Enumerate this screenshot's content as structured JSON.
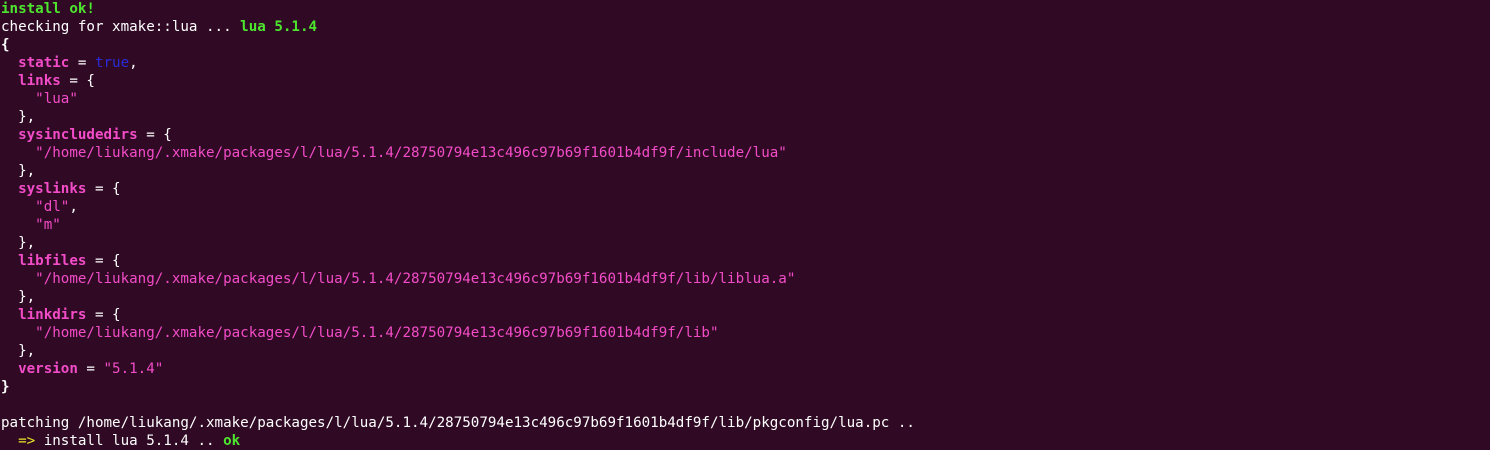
{
  "lines": [
    {
      "id": "install-ok",
      "segments": [
        {
          "t": "install ok!",
          "c": "g"
        }
      ]
    },
    {
      "id": "checking",
      "segments": [
        {
          "t": "checking for xmake::lua ... ",
          "c": "w"
        },
        {
          "t": "lua 5.1.4",
          "c": "g"
        }
      ]
    },
    {
      "id": "open-brace",
      "segments": [
        {
          "t": "{",
          "c": "wb"
        }
      ]
    },
    {
      "id": "static",
      "segments": [
        {
          "t": "  ",
          "c": "w"
        },
        {
          "t": "static",
          "c": "mb"
        },
        {
          "t": " = ",
          "c": "w"
        },
        {
          "t": "true",
          "c": "b"
        },
        {
          "t": ",",
          "c": "w"
        }
      ]
    },
    {
      "id": "links",
      "segments": [
        {
          "t": "  ",
          "c": "w"
        },
        {
          "t": "links",
          "c": "mb"
        },
        {
          "t": " = {",
          "c": "w"
        }
      ]
    },
    {
      "id": "links-lua",
      "segments": [
        {
          "t": "    ",
          "c": "w"
        },
        {
          "t": "\"lua\"",
          "c": "m"
        }
      ]
    },
    {
      "id": "links-close",
      "segments": [
        {
          "t": "  },",
          "c": "w"
        }
      ]
    },
    {
      "id": "sysincludedirs",
      "segments": [
        {
          "t": "  ",
          "c": "w"
        },
        {
          "t": "sysincludedirs",
          "c": "mb"
        },
        {
          "t": " = {",
          "c": "w"
        }
      ]
    },
    {
      "id": "sysincludedirs-path",
      "segments": [
        {
          "t": "    ",
          "c": "w"
        },
        {
          "t": "\"/home/liukang/.xmake/packages/l/lua/5.1.4/28750794e13c496c97b69f1601b4df9f/include/lua\"",
          "c": "m"
        }
      ]
    },
    {
      "id": "sysincludedirs-close",
      "segments": [
        {
          "t": "  },",
          "c": "w"
        }
      ]
    },
    {
      "id": "syslinks",
      "segments": [
        {
          "t": "  ",
          "c": "w"
        },
        {
          "t": "syslinks",
          "c": "mb"
        },
        {
          "t": " = {",
          "c": "w"
        }
      ]
    },
    {
      "id": "syslinks-dl",
      "segments": [
        {
          "t": "    ",
          "c": "w"
        },
        {
          "t": "\"dl\"",
          "c": "m"
        },
        {
          "t": ",",
          "c": "w"
        }
      ]
    },
    {
      "id": "syslinks-m",
      "segments": [
        {
          "t": "    ",
          "c": "w"
        },
        {
          "t": "\"m\"",
          "c": "m"
        }
      ]
    },
    {
      "id": "syslinks-close",
      "segments": [
        {
          "t": "  },",
          "c": "w"
        }
      ]
    },
    {
      "id": "libfiles",
      "segments": [
        {
          "t": "  ",
          "c": "w"
        },
        {
          "t": "libfiles",
          "c": "mb"
        },
        {
          "t": " = {",
          "c": "w"
        }
      ]
    },
    {
      "id": "libfiles-path",
      "segments": [
        {
          "t": "    ",
          "c": "w"
        },
        {
          "t": "\"/home/liukang/.xmake/packages/l/lua/5.1.4/28750794e13c496c97b69f1601b4df9f/lib/liblua.a\"",
          "c": "m"
        }
      ]
    },
    {
      "id": "libfiles-close",
      "segments": [
        {
          "t": "  },",
          "c": "w"
        }
      ]
    },
    {
      "id": "linkdirs",
      "segments": [
        {
          "t": "  ",
          "c": "w"
        },
        {
          "t": "linkdirs",
          "c": "mb"
        },
        {
          "t": " = {",
          "c": "w"
        }
      ]
    },
    {
      "id": "linkdirs-path",
      "segments": [
        {
          "t": "    ",
          "c": "w"
        },
        {
          "t": "\"/home/liukang/.xmake/packages/l/lua/5.1.4/28750794e13c496c97b69f1601b4df9f/lib\"",
          "c": "m"
        }
      ]
    },
    {
      "id": "linkdirs-close",
      "segments": [
        {
          "t": "  },",
          "c": "w"
        }
      ]
    },
    {
      "id": "version",
      "segments": [
        {
          "t": "  ",
          "c": "w"
        },
        {
          "t": "version",
          "c": "mb"
        },
        {
          "t": " = ",
          "c": "w"
        },
        {
          "t": "\"5.1.4\"",
          "c": "m"
        }
      ]
    },
    {
      "id": "close-brace",
      "segments": [
        {
          "t": "}",
          "c": "wb"
        }
      ]
    },
    {
      "id": "blank",
      "segments": [
        {
          "t": "",
          "c": "w"
        }
      ]
    },
    {
      "id": "patching",
      "segments": [
        {
          "t": "patching /home/liukang/.xmake/packages/l/lua/5.1.4/28750794e13c496c97b69f1601b4df9f/lib/pkgconfig/lua.pc ..",
          "c": "w"
        }
      ]
    },
    {
      "id": "install-result",
      "segments": [
        {
          "t": "  ",
          "c": "w"
        },
        {
          "t": "=>",
          "c": "y"
        },
        {
          "t": " install lua 5.1.4 .. ",
          "c": "w"
        },
        {
          "t": "ok",
          "c": "g"
        }
      ]
    }
  ]
}
